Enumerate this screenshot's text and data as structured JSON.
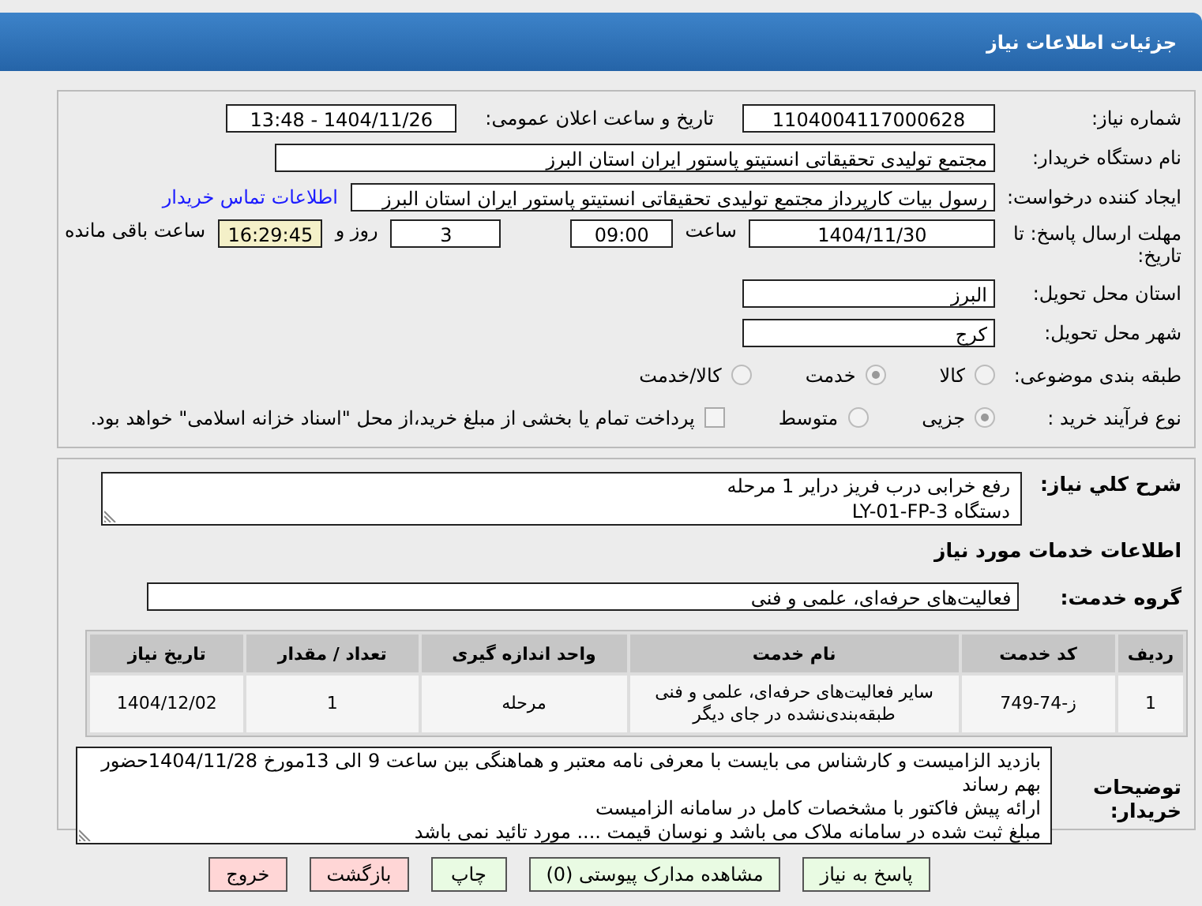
{
  "header": {
    "title": "جزئیات اطلاعات نیاز"
  },
  "details": {
    "need_number": {
      "label": "شماره نیاز:",
      "value": "1104004117000628"
    },
    "announce": {
      "label": "تاریخ و ساعت اعلان عمومی:",
      "value": "1404/11/26 - 13:48"
    },
    "buyer": {
      "label": "نام دستگاه خریدار:",
      "value": "مجتمع تولیدی تحقیقاتی انستیتو پاستور ایران استان البرز"
    },
    "creator": {
      "label": "ایجاد کننده درخواست:",
      "value": "رسول بیات کارپرداز مجتمع تولیدی تحقیقاتی انستیتو پاستور ایران استان البرز",
      "link": "اطلاعات تماس خریدار"
    },
    "deadline": {
      "label": "مهلت ارسال پاسخ: تا تاریخ:",
      "date": "1404/11/30",
      "time_label": "ساعت",
      "time": "09:00",
      "days": "3",
      "days_label": "روز و",
      "remaining": "16:29:45",
      "remaining_label": "ساعت باقی مانده"
    },
    "province": {
      "label": "استان محل تحویل:",
      "value": "البرز"
    },
    "city": {
      "label": "شهر محل تحویل:",
      "value": "کرج"
    },
    "category": {
      "label": "طبقه بندی موضوعی:",
      "options": [
        {
          "label": "کالا",
          "selected": false
        },
        {
          "label": "خدمت",
          "selected": true
        },
        {
          "label": "کالا/خدمت",
          "selected": false
        }
      ]
    },
    "process": {
      "label": "نوع فرآیند خرید :",
      "options": [
        {
          "label": "جزیی",
          "selected": true
        },
        {
          "label": "متوسط",
          "selected": false
        }
      ],
      "payment": {
        "label": "پرداخت تمام یا بخشی از مبلغ خرید،از محل \"اسناد خزانه اسلامی\" خواهد بود.",
        "checked": false
      }
    }
  },
  "need": {
    "summary_label": "شرح کلي نياز:",
    "summary": [
      "رفع خرابی درب فریز درایر 1 مرحله",
      "دستگاه LY-01-FP-3"
    ],
    "services_heading": "اطلاعات خدمات مورد نیاز",
    "group_label": "گروه خدمت:",
    "group": "فعالیت‌های حرفه‌ای، علمی و فنی",
    "table": {
      "columns": [
        "ردیف",
        "کد خدمت",
        "نام خدمت",
        "واحد اندازه گیری",
        "تعداد / مقدار",
        "تاریخ نیاز"
      ],
      "rows": [
        [
          "1",
          "ز-74-749",
          "سایر فعالیت‌های حرفه‌ای، علمی و فنی طبقه‌بندی‌نشده در جای دیگر",
          "مرحله",
          "1",
          "1404/12/02"
        ]
      ]
    },
    "notes_label": "توضیحات خریدار:",
    "notes": [
      "بازدید الزامیست و کارشناس می بایست با معرفی نامه معتبر و هماهنگی بین ساعت 9 الی 13مورخ 1404/11/28حضور بهم رساند",
      "ارائه پیش فاکتور با مشخصات کامل در سامانه الزامیست",
      "مبلغ ثبت شده در سامانه ملاک می باشد و نوسان قیمت .... مورد تائید نمی باشد"
    ]
  },
  "buttons": [
    {
      "label": "پاسخ به نیاز",
      "kind": "action"
    },
    {
      "label": "مشاهده مدارک پیوستی (0)",
      "kind": "action"
    },
    {
      "label": "چاپ",
      "kind": "action"
    },
    {
      "label": "بازگشت",
      "kind": "exit"
    },
    {
      "label": "خروج",
      "kind": "exit"
    }
  ]
}
